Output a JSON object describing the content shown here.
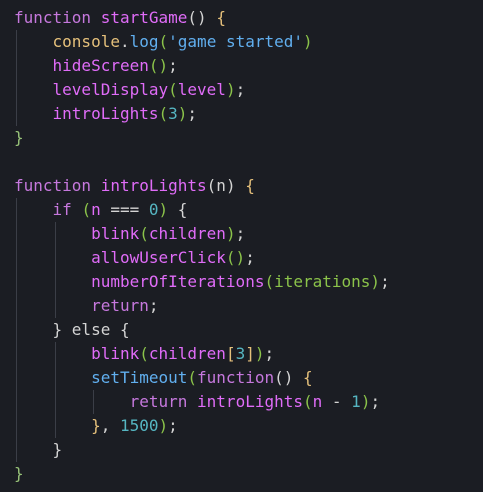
{
  "editor": {
    "theme": {
      "background": "#1b1d23",
      "guide": "#3b3e47",
      "keyword": "#c678dd",
      "function": "#e06cf8",
      "paren": "#8bc34a",
      "brace": "#98c379",
      "plain": "#d4d4d4",
      "string": "#61afef",
      "number": "#56b6c2",
      "builtin": "#e5c07b",
      "member": "#61afef"
    },
    "lines": [
      {
        "indent": 0,
        "segments": [
          {
            "t": "function",
            "c": "keyword"
          },
          {
            "t": " ",
            "c": "plain"
          },
          {
            "t": "startGame",
            "c": "function"
          },
          {
            "t": "() ",
            "c": "plain"
          },
          {
            "t": "{",
            "c": "builtin"
          }
        ]
      },
      {
        "indent": 1,
        "segments": [
          {
            "t": "console",
            "c": "builtin"
          },
          {
            "t": ".",
            "c": "plain"
          },
          {
            "t": "log",
            "c": "member"
          },
          {
            "t": "(",
            "c": "paren"
          },
          {
            "t": "'game started'",
            "c": "string"
          },
          {
            "t": ")",
            "c": "paren"
          }
        ]
      },
      {
        "indent": 1,
        "segments": [
          {
            "t": "hideScreen",
            "c": "function"
          },
          {
            "t": "()",
            "c": "paren"
          },
          {
            "t": ";",
            "c": "plain"
          }
        ]
      },
      {
        "indent": 1,
        "segments": [
          {
            "t": "levelDisplay",
            "c": "function"
          },
          {
            "t": "(",
            "c": "paren"
          },
          {
            "t": "level",
            "c": "function"
          },
          {
            "t": ")",
            "c": "paren"
          },
          {
            "t": ";",
            "c": "plain"
          }
        ]
      },
      {
        "indent": 1,
        "segments": [
          {
            "t": "introLights",
            "c": "function"
          },
          {
            "t": "(",
            "c": "paren"
          },
          {
            "t": "3",
            "c": "number"
          },
          {
            "t": ")",
            "c": "paren"
          },
          {
            "t": ";",
            "c": "plain"
          }
        ]
      },
      {
        "indent": 0,
        "segments": [
          {
            "t": "}",
            "c": "brace"
          }
        ]
      },
      {
        "indent": 0,
        "segments": []
      },
      {
        "indent": 0,
        "segments": [
          {
            "t": "function",
            "c": "keyword"
          },
          {
            "t": " ",
            "c": "plain"
          },
          {
            "t": "introLights",
            "c": "function"
          },
          {
            "t": "(n) ",
            "c": "plain"
          },
          {
            "t": "{",
            "c": "builtin"
          }
        ]
      },
      {
        "indent": 1,
        "segments": [
          {
            "t": "if",
            "c": "keyword"
          },
          {
            "t": " ",
            "c": "plain"
          },
          {
            "t": "(",
            "c": "paren"
          },
          {
            "t": "n ",
            "c": "function"
          },
          {
            "t": "=== ",
            "c": "plain"
          },
          {
            "t": "0",
            "c": "number"
          },
          {
            "t": ")",
            "c": "paren"
          },
          {
            "t": " {",
            "c": "plain"
          }
        ]
      },
      {
        "indent": 2,
        "segments": [
          {
            "t": "blink",
            "c": "function"
          },
          {
            "t": "(",
            "c": "paren"
          },
          {
            "t": "children",
            "c": "function"
          },
          {
            "t": ")",
            "c": "paren"
          },
          {
            "t": ";",
            "c": "plain"
          }
        ]
      },
      {
        "indent": 2,
        "segments": [
          {
            "t": "allowUserClick",
            "c": "function"
          },
          {
            "t": "()",
            "c": "paren"
          },
          {
            "t": ";",
            "c": "plain"
          }
        ]
      },
      {
        "indent": 2,
        "segments": [
          {
            "t": "numberOfIterations",
            "c": "function"
          },
          {
            "t": "(",
            "c": "paren"
          },
          {
            "t": "iterations",
            "c": "paren"
          },
          {
            "t": ")",
            "c": "paren"
          },
          {
            "t": ";",
            "c": "plain"
          }
        ]
      },
      {
        "indent": 2,
        "segments": [
          {
            "t": "return",
            "c": "keyword"
          },
          {
            "t": ";",
            "c": "plain"
          }
        ]
      },
      {
        "indent": 1,
        "segments": [
          {
            "t": "} else {",
            "c": "plain"
          }
        ]
      },
      {
        "indent": 2,
        "segments": [
          {
            "t": "blink",
            "c": "function"
          },
          {
            "t": "(",
            "c": "paren"
          },
          {
            "t": "children",
            "c": "function"
          },
          {
            "t": "[",
            "c": "builtin"
          },
          {
            "t": "3",
            "c": "number"
          },
          {
            "t": "]",
            "c": "builtin"
          },
          {
            "t": ")",
            "c": "paren"
          },
          {
            "t": ";",
            "c": "plain"
          }
        ]
      },
      {
        "indent": 2,
        "segments": [
          {
            "t": "setTimeout",
            "c": "member"
          },
          {
            "t": "(",
            "c": "paren"
          },
          {
            "t": "function",
            "c": "keyword"
          },
          {
            "t": "() ",
            "c": "plain"
          },
          {
            "t": "{",
            "c": "builtin"
          }
        ]
      },
      {
        "indent": 3,
        "segments": [
          {
            "t": "return",
            "c": "keyword"
          },
          {
            "t": " ",
            "c": "plain"
          },
          {
            "t": "introLights",
            "c": "function"
          },
          {
            "t": "(",
            "c": "paren"
          },
          {
            "t": "n ",
            "c": "function"
          },
          {
            "t": "- ",
            "c": "plain"
          },
          {
            "t": "1",
            "c": "number"
          },
          {
            "t": ")",
            "c": "paren"
          },
          {
            "t": ";",
            "c": "plain"
          }
        ]
      },
      {
        "indent": 2,
        "segments": [
          {
            "t": "}",
            "c": "builtin"
          },
          {
            "t": ", ",
            "c": "plain"
          },
          {
            "t": "1500",
            "c": "number"
          },
          {
            "t": ")",
            "c": "paren"
          },
          {
            "t": ";",
            "c": "plain"
          }
        ]
      },
      {
        "indent": 1,
        "segments": [
          {
            "t": "}",
            "c": "plain"
          }
        ]
      },
      {
        "indent": 0,
        "segments": [
          {
            "t": "}",
            "c": "brace"
          }
        ]
      }
    ]
  }
}
